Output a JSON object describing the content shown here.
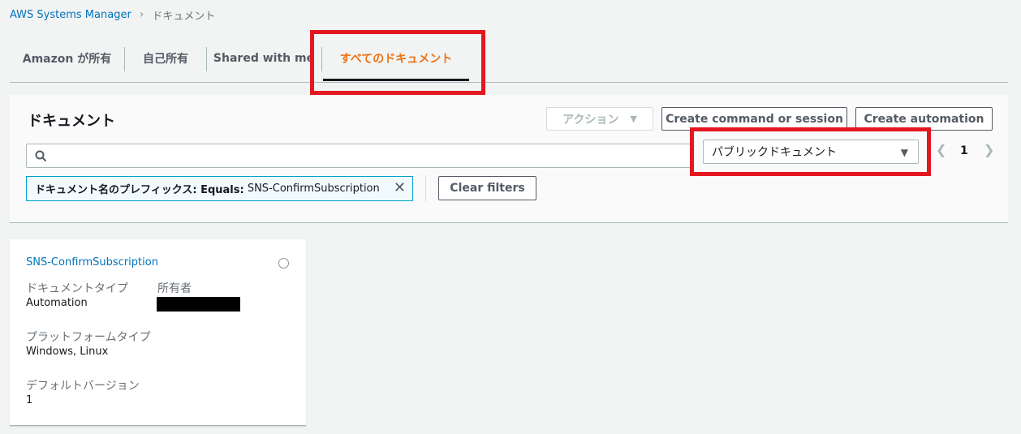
{
  "breadcrumb": {
    "service": "AWS Systems Manager",
    "separator": "›",
    "current": "ドキュメント"
  },
  "tabs": [
    {
      "label": "Amazon が所有"
    },
    {
      "label": "自己所有"
    },
    {
      "label": "Shared with me"
    },
    {
      "label": "すべてのドキュメント",
      "active": true
    }
  ],
  "panel": {
    "title": "ドキュメント",
    "actions_label": "アクション",
    "create_command_label": "Create command or session",
    "create_automation_label": "Create automation",
    "search_value": "",
    "select_value": "パブリックドキュメント",
    "page_number": "1",
    "filter": {
      "key": "ドキュメント名のプレフィックス: Equals:",
      "value": " SNS-ConfirmSubscription"
    },
    "clear_filters_label": "Clear filters"
  },
  "card": {
    "title": "SNS-ConfirmSubscription",
    "doc_type_label": "ドキュメントタイプ",
    "doc_type_value": "Automation",
    "owner_label": "所有者",
    "platform_label": "プラットフォームタイプ",
    "platform_value": "Windows, Linux",
    "default_version_label": "デフォルトバージョン",
    "default_version_value": "1"
  },
  "icons": {
    "search": "search-icon",
    "caret": "caret-down-icon",
    "close": "close-icon",
    "chevron_left": "chevron-left-icon",
    "chevron_right": "chevron-right-icon"
  },
  "colors": {
    "link": "#0073bb",
    "active_tab": "#ec7211",
    "highlight": "#e3171f",
    "token_border": "#00a1c9"
  }
}
